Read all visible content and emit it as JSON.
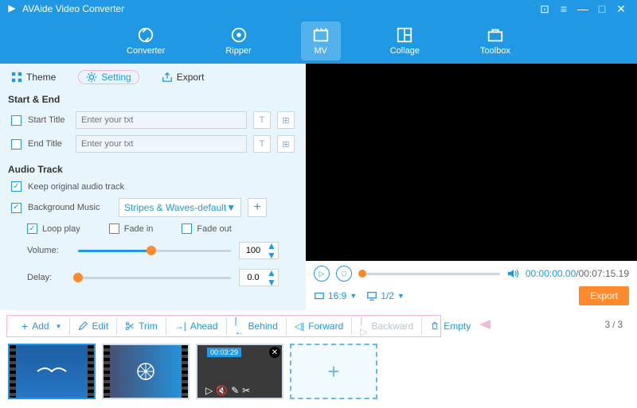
{
  "app": {
    "title": "AVAide Video Converter"
  },
  "nav": {
    "converter": "Converter",
    "ripper": "Ripper",
    "mv": "MV",
    "collage": "Collage",
    "toolbox": "Toolbox"
  },
  "tabs": {
    "theme": "Theme",
    "setting": "Setting",
    "export": "Export"
  },
  "start_end": {
    "heading": "Start & End",
    "start_label": "Start Title",
    "end_label": "End Title",
    "placeholder": "Enter your txt"
  },
  "audio": {
    "heading": "Audio Track",
    "keep_original": "Keep original audio track",
    "bg_music": "Background Music",
    "bg_dropdown": "Stripes & Waves-default",
    "loop": "Loop play",
    "fade_in": "Fade in",
    "fade_out": "Fade out",
    "volume_label": "Volume:",
    "volume_value": "100",
    "delay_label": "Delay:",
    "delay_value": "0.0"
  },
  "playback": {
    "current": "00:00:00.00",
    "total": "/00:07:15.19",
    "aspect": "16:9",
    "page": "1/2"
  },
  "export_btn": "Export",
  "toolbar": {
    "add": "Add",
    "edit": "Edit",
    "trim": "Trim",
    "ahead": "Ahead",
    "behind": "Behind",
    "forward": "Forward",
    "backward": "Backward",
    "empty": "Empty"
  },
  "counter": {
    "cur": "3",
    "tot": "3"
  },
  "thumb3": {
    "time": "00:03:29"
  }
}
